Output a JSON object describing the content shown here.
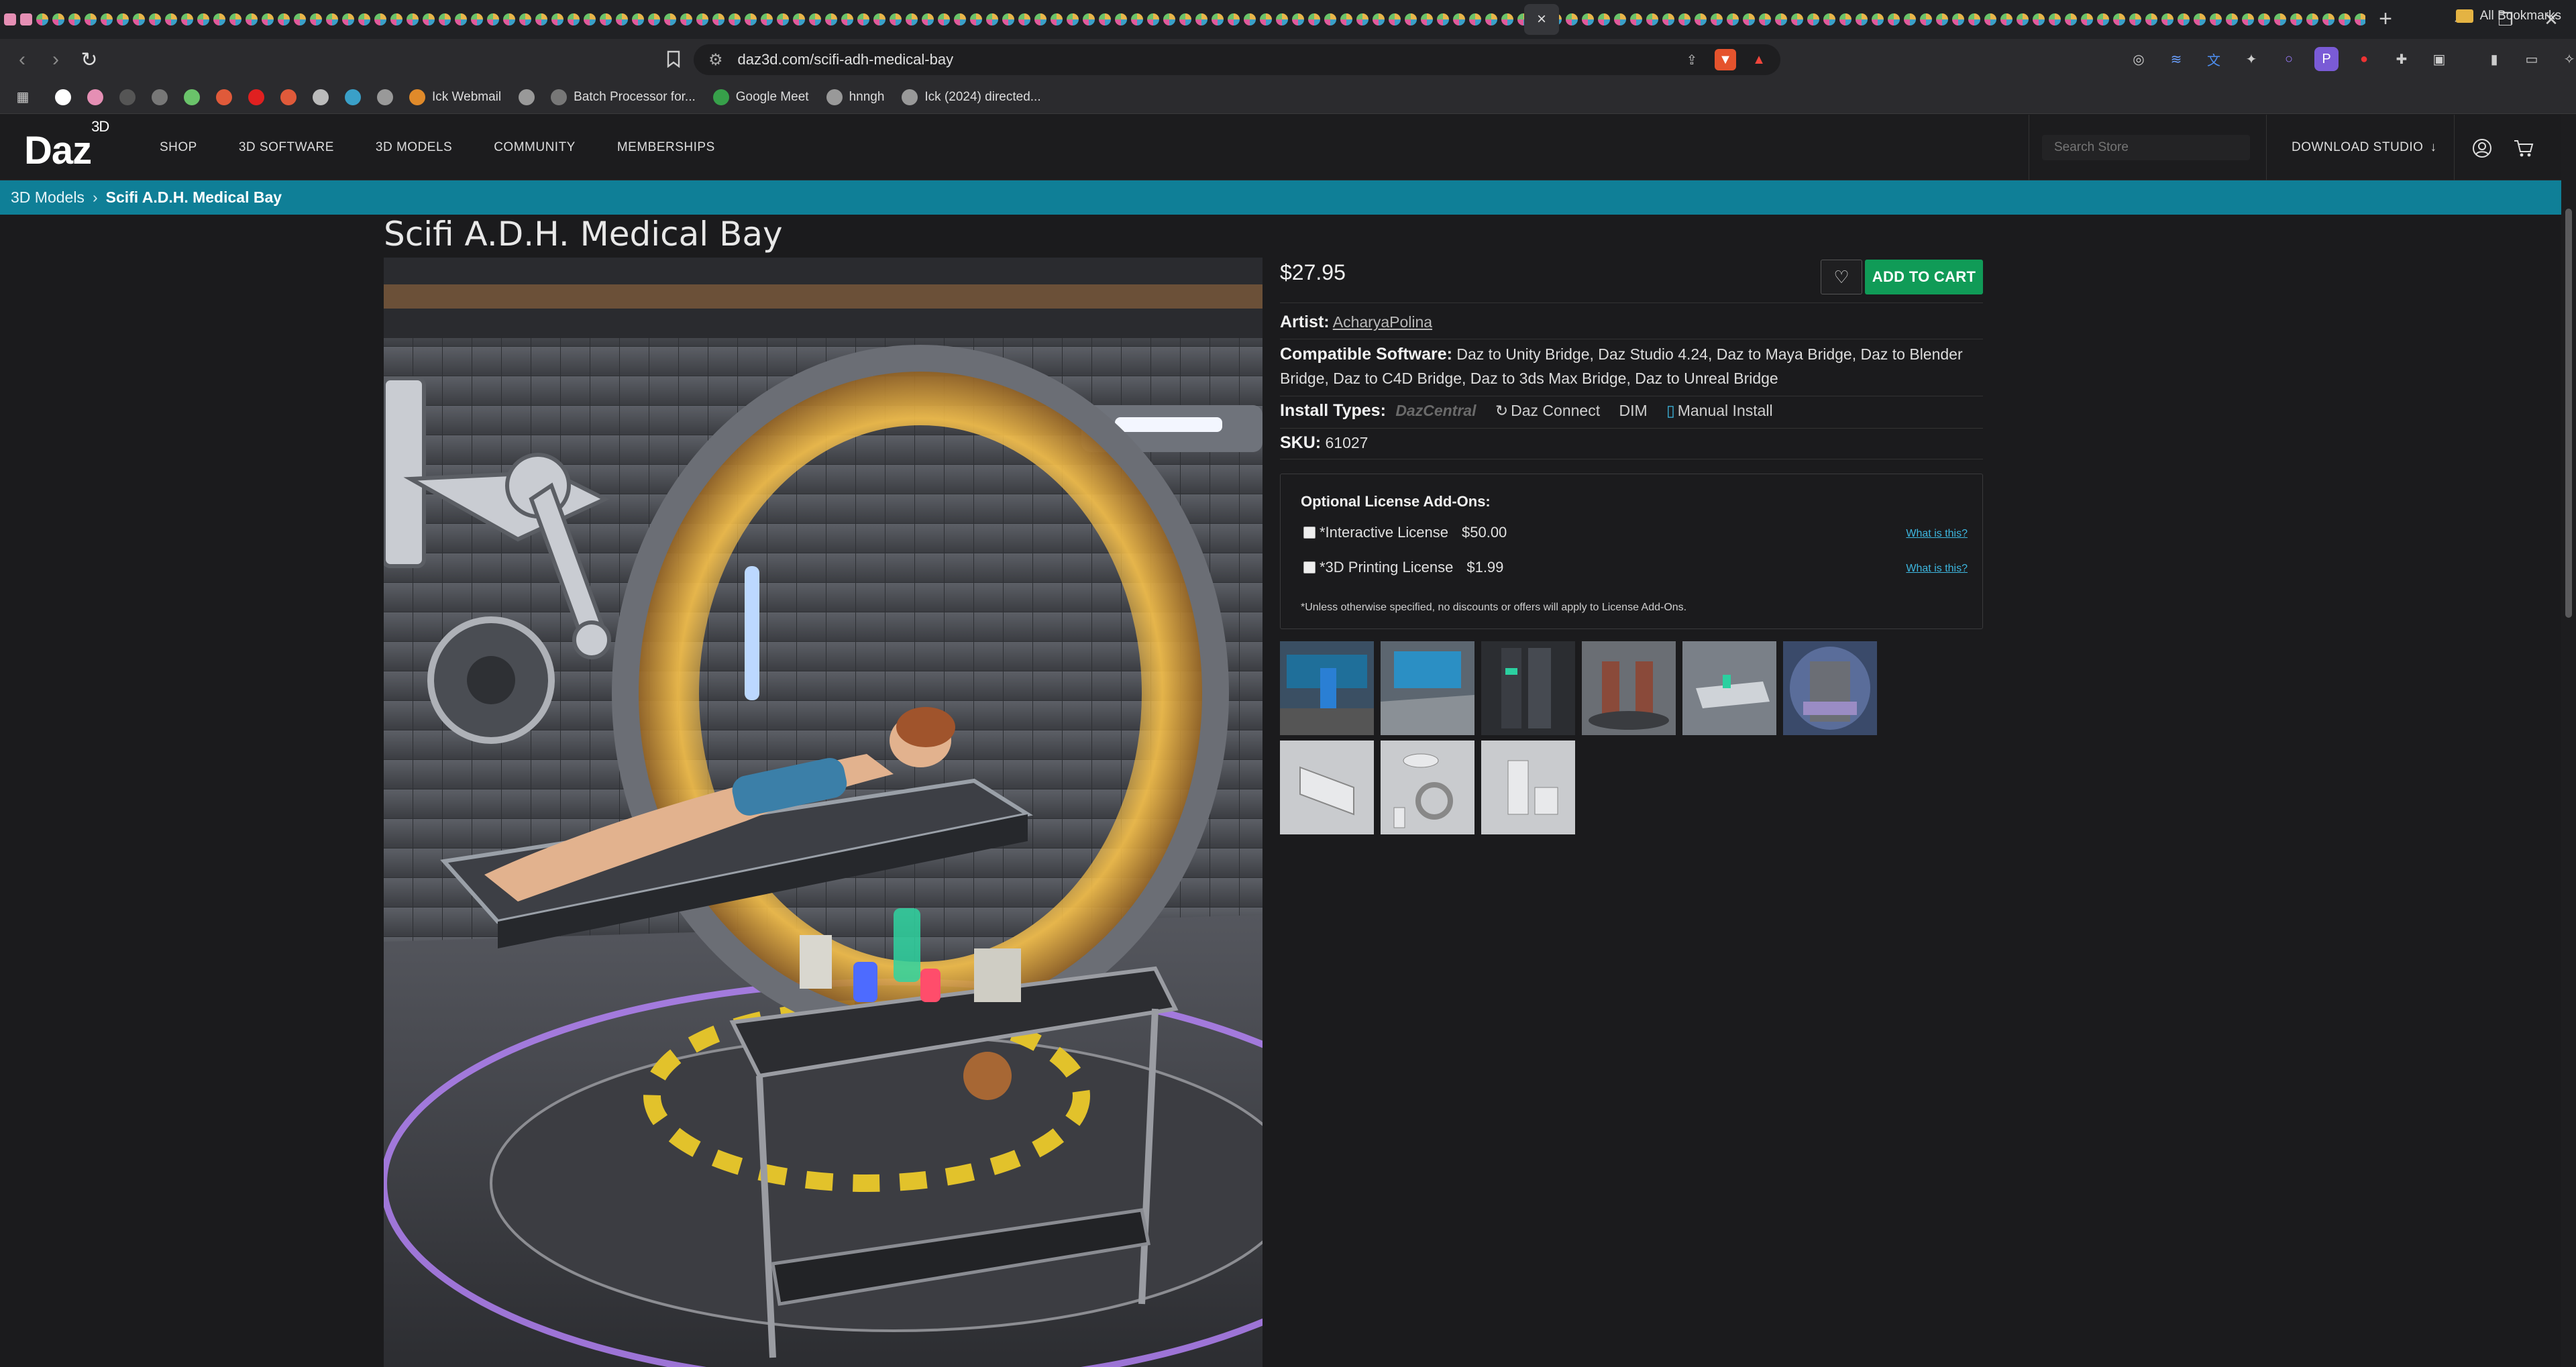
{
  "browser": {
    "active_tab_close": "×",
    "url": "daz3d.com/scifi-adh-medical-bay",
    "bookmarks": [
      {
        "label": "",
        "icon": "google-icon"
      },
      {
        "label": "",
        "icon": "ghost-icon"
      },
      {
        "label": "",
        "icon": "circle-icon"
      },
      {
        "label": "",
        "icon": "chat-icon"
      },
      {
        "label": "",
        "icon": "game-icon"
      },
      {
        "label": "",
        "icon": "reddit-icon"
      },
      {
        "label": "",
        "icon": "youtube-icon"
      },
      {
        "label": "",
        "icon": "folder-icon"
      },
      {
        "label": "",
        "icon": "pocket-icon"
      },
      {
        "label": "",
        "icon": "target-icon"
      },
      {
        "label": "",
        "icon": "gear-icon"
      },
      {
        "label": "Ick Webmail",
        "icon": "mail-icon"
      },
      {
        "label": "",
        "icon": "globe-icon"
      },
      {
        "label": "Batch Processor for...",
        "icon": "doc-icon"
      },
      {
        "label": "Google Meet",
        "icon": "meet-icon"
      },
      {
        "label": "hnngh",
        "icon": "globe-icon"
      },
      {
        "label": "Ick (2024) directed...",
        "icon": "globe-icon"
      }
    ],
    "all_bookmarks": "All Bookmarks"
  },
  "site": {
    "logo": "Daz",
    "logo_sup": "3D",
    "nav": [
      "SHOP",
      "3D SOFTWARE",
      "3D MODELS",
      "COMMUNITY",
      "MEMBERSHIPS"
    ],
    "search_placeholder": "Search Store",
    "download_studio": "DOWNLOAD STUDIO",
    "download_arrow": "↓"
  },
  "breadcrumb": {
    "parent": "3D Models",
    "separator": "›",
    "current": "Scifi A.D.H. Medical Bay"
  },
  "product": {
    "title": "Scifi A.D.H. Medical Bay",
    "price": "$27.95",
    "wishlist_icon": "♡",
    "add_to_cart": "ADD TO CART",
    "artist_label": "Artist:",
    "artist": "AcharyaPolina",
    "compatible_label": "Compatible Software:",
    "compatible": "Daz to Unity Bridge, Daz Studio 4.24, Daz to Maya Bridge, Daz to Blender Bridge, Daz to C4D Bridge, Daz to 3ds Max Bridge, Daz to Unreal Bridge",
    "install_label": "Install Types:",
    "install_types": [
      "DazCentral",
      "Daz Connect",
      "DIM",
      "Manual Install"
    ],
    "sku_label": "SKU:",
    "sku": "61027"
  },
  "addons": {
    "title": "Optional License Add-Ons:",
    "licenses": [
      {
        "name": "*Interactive License",
        "price": "$50.00",
        "help": "What is this?"
      },
      {
        "name": "*3D Printing License",
        "price": "$1.99",
        "help": "What is this?"
      }
    ],
    "note": "*Unless otherwise specified, no discounts or offers will apply to License Add-Ons."
  },
  "colors": {
    "accent": "#0f7f97",
    "add_to_cart": "#109b57",
    "link": "#3db7e0"
  }
}
